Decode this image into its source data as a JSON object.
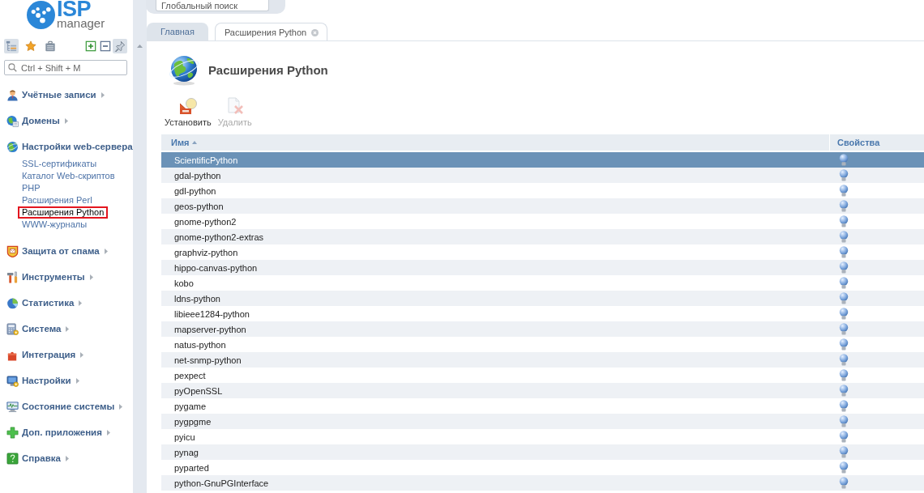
{
  "logo": {
    "name": "ISP",
    "tagline": "manager"
  },
  "sidebar_toolbar": {
    "left": [
      {
        "kind": "tree",
        "active": true
      },
      {
        "kind": "favorites",
        "active": false
      },
      {
        "kind": "clipboard",
        "active": false
      }
    ],
    "right": [
      {
        "kind": "expand",
        "active": false
      },
      {
        "kind": "collapse",
        "active": false
      },
      {
        "kind": "pin",
        "active": true
      }
    ]
  },
  "sidebar_search": {
    "placeholder": "Ctrl + Shift + M"
  },
  "menu": [
    {
      "label": "Учётные записи",
      "kind": "users",
      "expanded": false
    },
    {
      "label": "Домены",
      "kind": "domains",
      "expanded": false
    },
    {
      "label": "Настройки web-сервера",
      "kind": "webserver",
      "expanded": true,
      "children": [
        {
          "label": "SSL-сертификаты",
          "selected": false
        },
        {
          "label": "Каталог Web-скриптов",
          "selected": false
        },
        {
          "label": "PHP",
          "selected": false
        },
        {
          "label": "Расширения Perl",
          "selected": false
        },
        {
          "label": "Расширения Python",
          "selected": true
        },
        {
          "label": "WWW-журналы",
          "selected": false
        }
      ]
    },
    {
      "label": "Защита от спама",
      "kind": "spam",
      "expanded": false
    },
    {
      "label": "Инструменты",
      "kind": "tools",
      "expanded": false
    },
    {
      "label": "Статистика",
      "kind": "stats",
      "expanded": false
    },
    {
      "label": "Система",
      "kind": "system",
      "expanded": false
    },
    {
      "label": "Интеграция",
      "kind": "integration",
      "expanded": false
    },
    {
      "label": "Настройки",
      "kind": "settings",
      "expanded": false
    },
    {
      "label": "Состояние системы",
      "kind": "monitoring",
      "expanded": false
    },
    {
      "label": "Доп. приложения",
      "kind": "apps",
      "expanded": false
    },
    {
      "label": "Справка",
      "kind": "help",
      "expanded": false
    }
  ],
  "global_search": {
    "placeholder": "Глобальный поиск"
  },
  "tabs": [
    {
      "label": "Главная",
      "selected": false,
      "closable": false
    },
    {
      "label": "Расширения Python",
      "selected": true,
      "closable": true
    }
  ],
  "page": {
    "title": "Расширения Python"
  },
  "toolbar": [
    {
      "label": "Установить",
      "kind": "install",
      "disabled": false
    },
    {
      "label": "Удалить",
      "kind": "delete",
      "disabled": true
    }
  ],
  "table": {
    "columns": [
      {
        "label": "Имя",
        "sorted": true
      },
      {
        "label": "Свойства",
        "sorted": false
      }
    ],
    "rows": [
      {
        "name": "ScientificPython",
        "selected": true
      },
      {
        "name": "gdal-python",
        "selected": false
      },
      {
        "name": "gdl-python",
        "selected": false
      },
      {
        "name": "geos-python",
        "selected": false
      },
      {
        "name": "gnome-python2",
        "selected": false
      },
      {
        "name": "gnome-python2-extras",
        "selected": false
      },
      {
        "name": "graphviz-python",
        "selected": false
      },
      {
        "name": "hippo-canvas-python",
        "selected": false
      },
      {
        "name": "kobo",
        "selected": false
      },
      {
        "name": "ldns-python",
        "selected": false
      },
      {
        "name": "libieee1284-python",
        "selected": false
      },
      {
        "name": "mapserver-python",
        "selected": false
      },
      {
        "name": "natus-python",
        "selected": false
      },
      {
        "name": "net-snmp-python",
        "selected": false
      },
      {
        "name": "pexpect",
        "selected": false
      },
      {
        "name": "pyOpenSSL",
        "selected": false
      },
      {
        "name": "pygame",
        "selected": false
      },
      {
        "name": "pygpgme",
        "selected": false
      },
      {
        "name": "pyicu",
        "selected": false
      },
      {
        "name": "pynag",
        "selected": false
      },
      {
        "name": "pyparted",
        "selected": false
      },
      {
        "name": "python-GnuPGInterface",
        "selected": false
      }
    ]
  }
}
